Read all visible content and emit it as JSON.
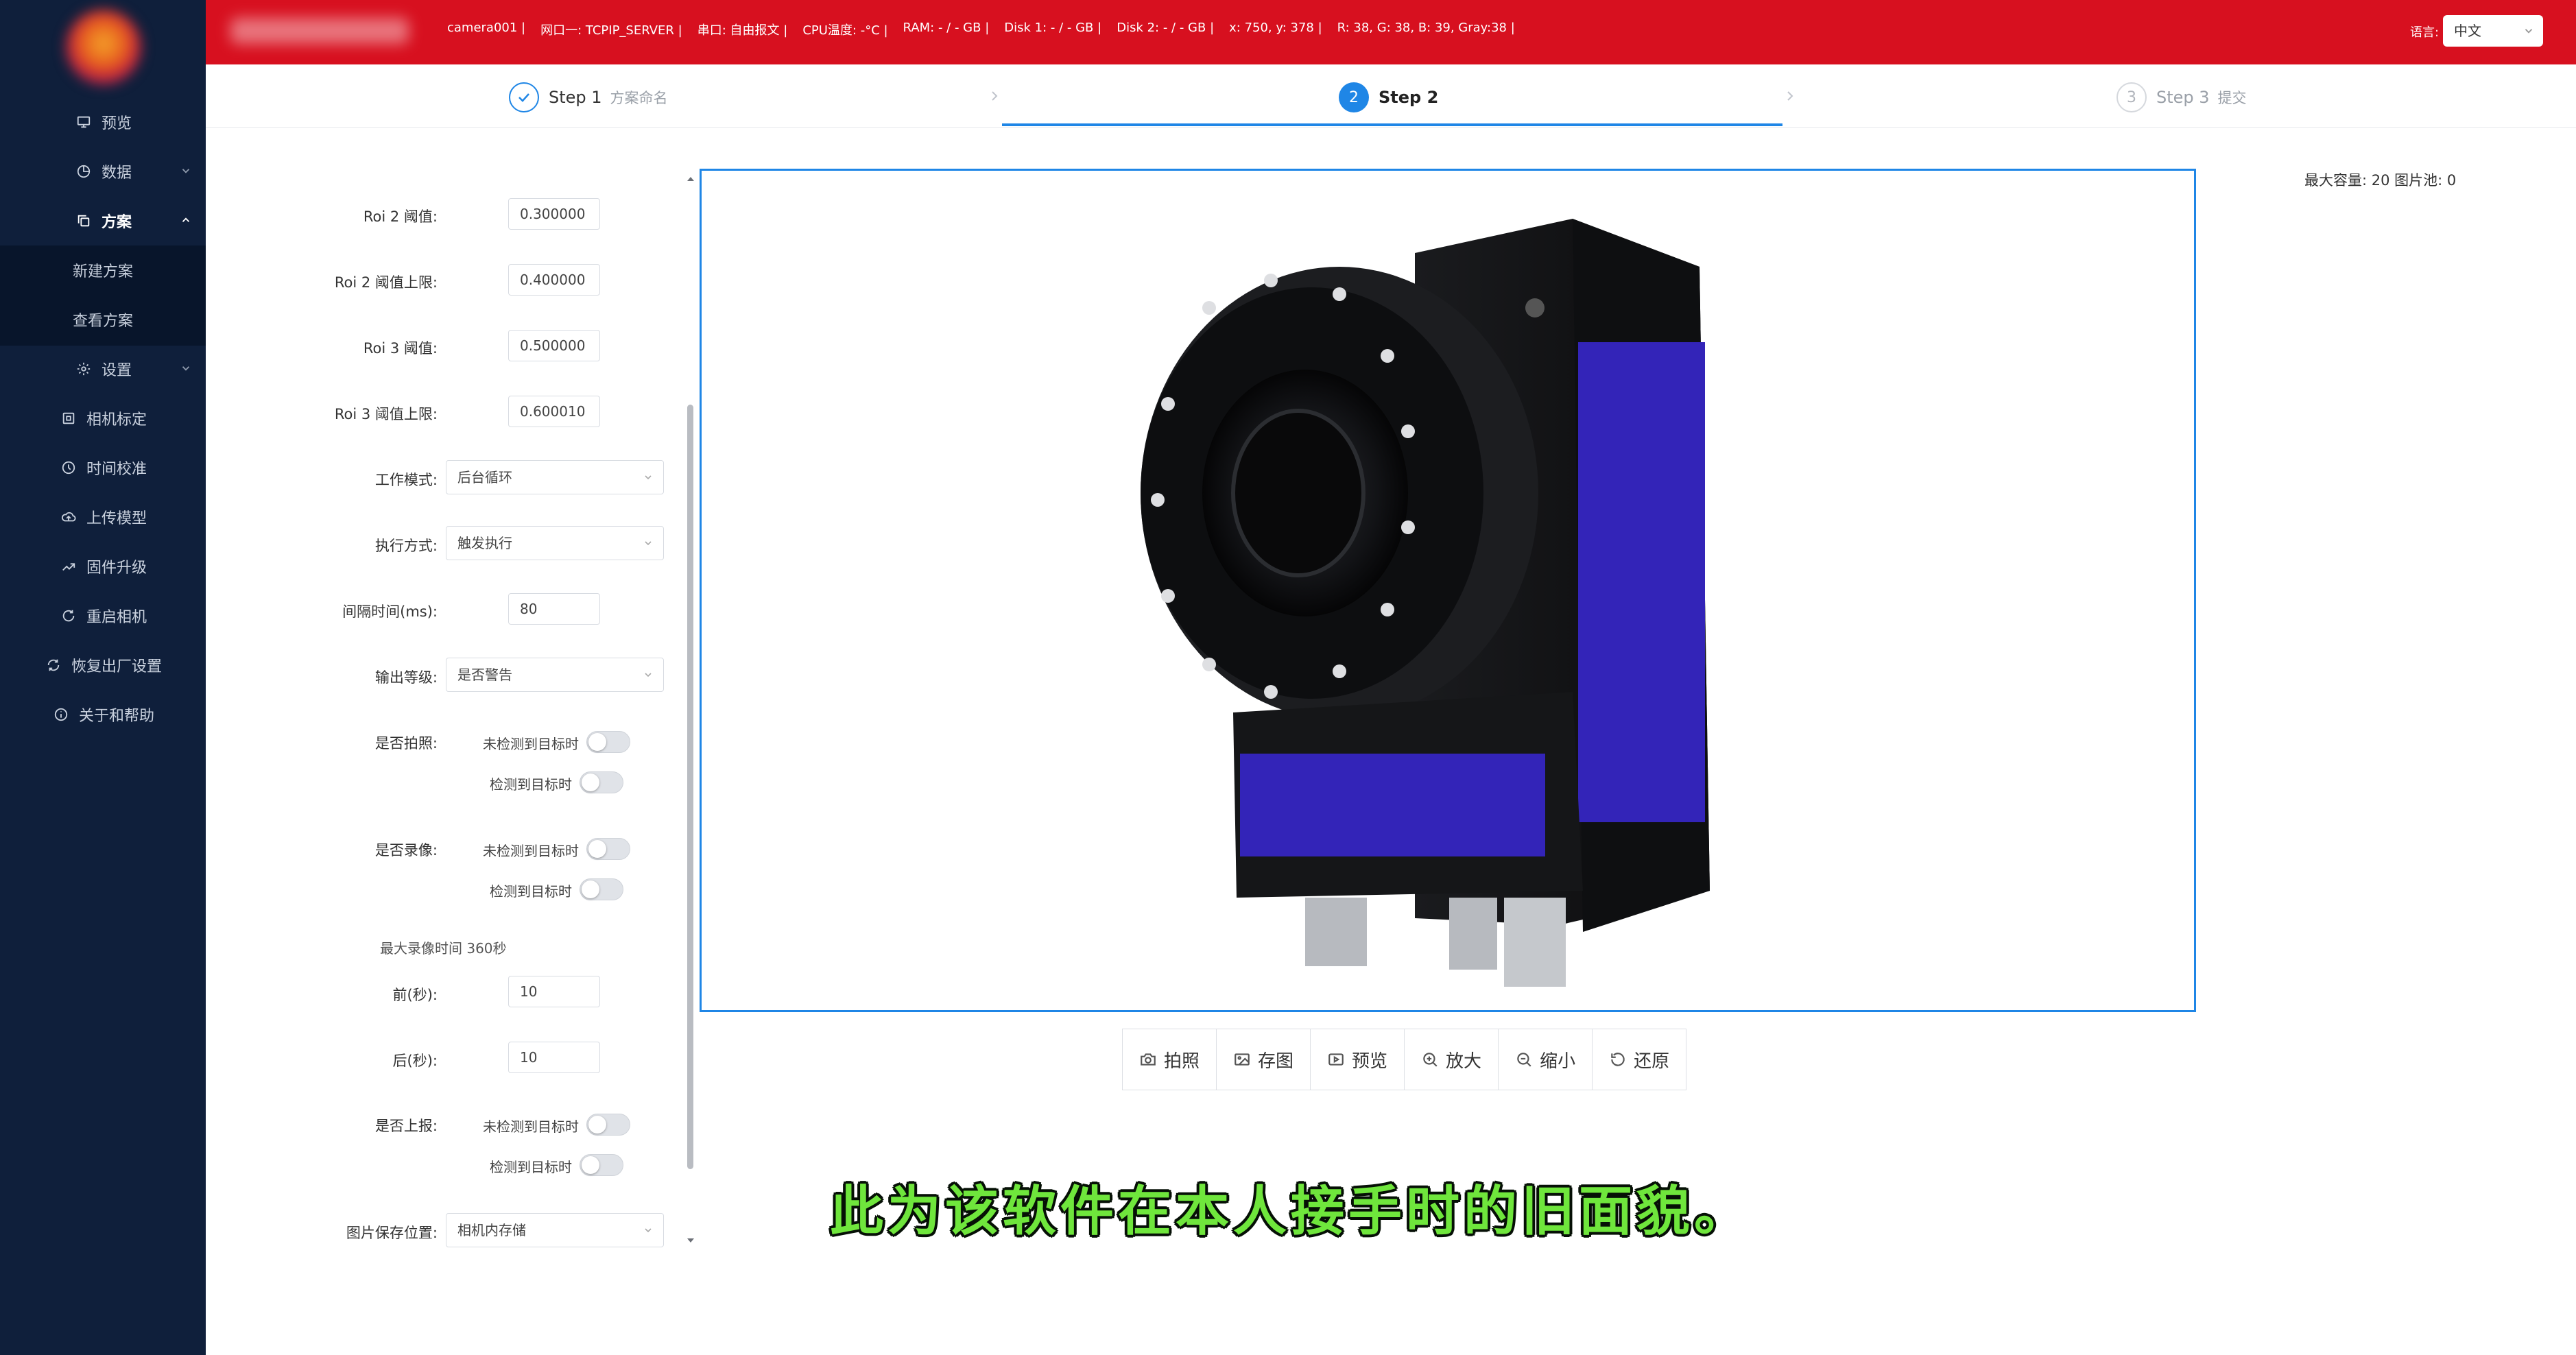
{
  "sidebar": {
    "items": [
      {
        "label": "预览",
        "icon": "monitor-icon"
      },
      {
        "label": "数据",
        "icon": "pie-chart-icon"
      },
      {
        "label": "方案",
        "icon": "copy-icon"
      },
      {
        "label": "设置",
        "icon": "gear-icon"
      },
      {
        "label": "相机标定",
        "icon": "calibrate-icon"
      },
      {
        "label": "时间校准",
        "icon": "clock-icon"
      },
      {
        "label": "上传模型",
        "icon": "cloud-upload-icon"
      },
      {
        "label": "固件升级",
        "icon": "trend-icon"
      },
      {
        "label": "重启相机",
        "icon": "restart-icon"
      },
      {
        "label": "恢复出厂设置",
        "icon": "refresh-icon"
      },
      {
        "label": "关于和帮助",
        "icon": "info-icon"
      }
    ],
    "submenu": [
      {
        "label": "新建方案"
      },
      {
        "label": "查看方案"
      }
    ]
  },
  "topbar": {
    "status": [
      "camera001  |",
      "网口一: TCPIP_SERVER  |",
      "串口: 自由报文  |",
      "CPU温度: -°C  |",
      "RAM: - / - GB  |",
      "Disk 1: - / - GB  |",
      "Disk 2: - / - GB  |",
      "x: 750, y: 378  |",
      "R: 38, G: 38, B: 39, Gray:38  |"
    ],
    "lang_label": "语言:",
    "lang_value": "中文"
  },
  "steps": [
    {
      "label": "Step 1",
      "sub": "方案命名",
      "state": "done"
    },
    {
      "label": "Step 2",
      "sub": "",
      "state": "active",
      "index": "2"
    },
    {
      "label": "Step 3",
      "sub": "提交",
      "state": "pending",
      "index": "3"
    }
  ],
  "form": {
    "roi2_threshold": {
      "label": "Roi 2 阈值:",
      "value": "0.300000"
    },
    "roi2_upper": {
      "label": "Roi 2 阈值上限:",
      "value": "0.400000"
    },
    "roi3_threshold": {
      "label": "Roi 3 阈值:",
      "value": "0.500000"
    },
    "roi3_upper": {
      "label": "Roi 3 阈值上限:",
      "value": "0.600010"
    },
    "work_mode": {
      "label": "工作模式:",
      "value": "后台循环"
    },
    "exec_mode": {
      "label": "执行方式:",
      "value": "触发执行"
    },
    "interval": {
      "label": "间隔时间(ms):",
      "value": "80"
    },
    "output_level": {
      "label": "输出等级:",
      "value": "是否警告"
    },
    "capture": {
      "label": "是否拍照:",
      "opt1": "未检测到目标时",
      "opt2": "检测到目标时"
    },
    "record": {
      "label": "是否录像:",
      "opt1": "未检测到目标时",
      "opt2": "检测到目标时"
    },
    "max_record_note": "最大录像时间 360秒",
    "before": {
      "label": "前(秒):",
      "value": "10"
    },
    "after": {
      "label": "后(秒):",
      "value": "10"
    },
    "report": {
      "label": "是否上报:",
      "opt1": "未检测到目标时",
      "opt2": "检测到目标时"
    },
    "save_location": {
      "label": "图片保存位置:",
      "value": "相机内存储"
    }
  },
  "preview": {
    "capacity": "最大容量: 20  图片池: 0"
  },
  "toolbar": [
    {
      "label": "拍照",
      "icon": "camera-icon"
    },
    {
      "label": "存图",
      "icon": "image-icon"
    },
    {
      "label": "预览",
      "icon": "play-icon"
    },
    {
      "label": "放大",
      "icon": "zoom-in-icon"
    },
    {
      "label": "缩小",
      "icon": "zoom-out-icon"
    },
    {
      "label": "还原",
      "icon": "reset-icon"
    }
  ],
  "caption": "此为该软件在本人接手时的旧面貌。",
  "colors": {
    "topbar": "#d7101f",
    "sidebar": "#0f1f3b",
    "accent": "#1f86e6",
    "caption": "#6fe63c"
  }
}
